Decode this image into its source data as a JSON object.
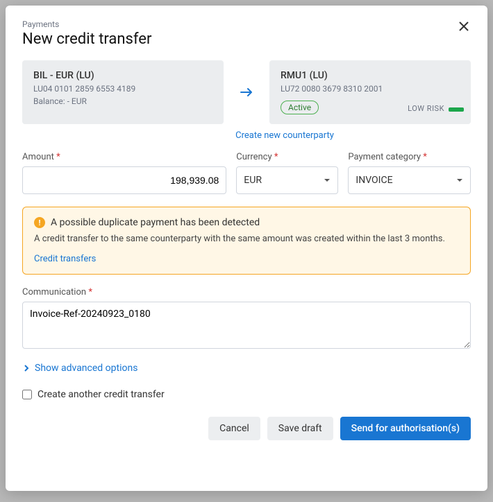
{
  "breadcrumb": "Payments",
  "title": "New credit transfer",
  "from_account": {
    "name": "BIL - EUR (LU)",
    "iban": "LU04 0101 2859 6553 4189",
    "balance_label": "Balance:  -  EUR"
  },
  "to_account": {
    "name": "RMU1 (LU)",
    "iban": "LU72 0080 3679 8310 2001",
    "status": "Active",
    "risk_label": "LOW RISK"
  },
  "create_counterparty_label": "Create new counterparty",
  "fields": {
    "amount_label": "Amount",
    "amount_value": "198,939.08",
    "currency_label": "Currency",
    "currency_value": "EUR",
    "category_label": "Payment category",
    "category_value": "INVOICE"
  },
  "alert": {
    "title": "A possible duplicate payment has been detected",
    "body": "A credit transfer to the same counterparty with the same amount was created within the last 3 months.",
    "link": "Credit transfers"
  },
  "communication": {
    "label": "Communication",
    "value": "Invoice-Ref-20240923_0180"
  },
  "advanced_label": "Show advanced options",
  "checkbox_label": "Create another credit transfer",
  "buttons": {
    "cancel": "Cancel",
    "save_draft": "Save draft",
    "send": "Send for authorisation(s)"
  }
}
